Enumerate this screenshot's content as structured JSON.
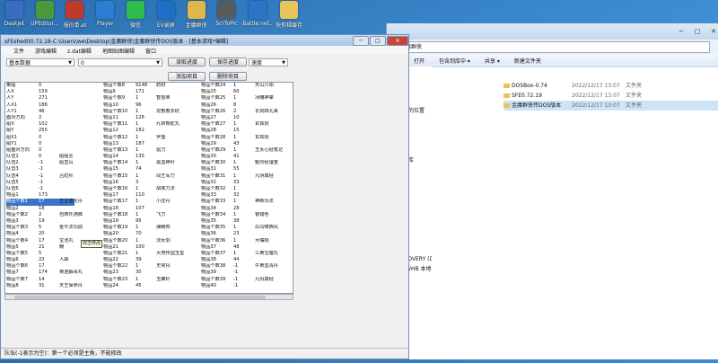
{
  "desktop": {
    "icons": [
      {
        "label": "Deskjet",
        "color": "#3b6cc4"
      },
      {
        "label": "UPEditor...",
        "color": "#4a9a3c"
      },
      {
        "label": "报价单.et",
        "color": "#c0392b"
      },
      {
        "label": "Player",
        "color": "#2a7fd4"
      },
      {
        "label": "微信",
        "color": "#2dbd4a"
      },
      {
        "label": "EV录屏",
        "color": "#1e6fc8"
      },
      {
        "label": "金庸群侠",
        "color": "#e0b84a"
      },
      {
        "label": "ScrToPic",
        "color": "#5a5a5a"
      },
      {
        "label": "Battle.net...",
        "color": "#2c74c9"
      },
      {
        "label": "快剪辑缓存",
        "color": "#e8c45a"
      }
    ]
  },
  "explorer": {
    "path": "金庸群侠",
    "toolbar": [
      "打开",
      "包含到库中 ▾",
      "共享 ▾",
      "新建文件夹"
    ],
    "sidebar": [
      "",
      "",
      "下载",
      "桌面",
      "最近访问的位置",
      "",
      "",
      "",
      "",
      "暴风影视库",
      "视频",
      "图片",
      "文档",
      "迅雷下载",
      "音乐",
      "",
      "",
      "计算机",
      "OS (C:)",
      "HP_RECOVERY (D:)",
      "Users (WHB 本地)",
      "",
      "",
      "网络",
      "",
      "",
      "",
      "",
      "",
      ""
    ],
    "files": [
      {
        "name": "DOSBox-0.74",
        "date": "2022/12/17 13:07",
        "type": "文件夹"
      },
      {
        "name": "SFE0.72.19",
        "date": "2022/12/17 13:07",
        "type": "文件夹"
      },
      {
        "name": "金庸群侠传DOS版本",
        "date": "2022/12/17 13:07",
        "type": "文件夹"
      }
    ]
  },
  "editor": {
    "title": "sFEshedit0.72.18-C:\\Users\\we\\Desktop\\金庸群侠\\金庸群侠传DOS版本 - [基本游戏*编辑]",
    "menu": [
      "文件",
      "游戏编辑",
      "z.dat编辑",
      "地图贴图编辑",
      "窗口"
    ],
    "select_category": "基本数据",
    "select_value": "0",
    "select_right": "速度",
    "buttons": {
      "read": "读取进度",
      "save": "保存进度",
      "add": "添加项目",
      "delete": "删除项目"
    },
    "tooltip": "双击修改",
    "status": "队伍(-1表示为空)：第一个必须是主角，不能修改",
    "grid": {
      "col1": [
        [
          "乘船",
          "0"
        ],
        [
          "人X",
          "159"
        ],
        [
          "人Y",
          "271"
        ],
        [
          "人X1",
          "186"
        ],
        [
          "人Y1",
          "46"
        ],
        [
          "面对方向",
          "2"
        ],
        [
          "船X",
          "102"
        ],
        [
          "船Y",
          "255"
        ],
        [
          "船X1",
          "0"
        ],
        [
          "船Y1",
          "0"
        ],
        [
          "船面对方向",
          "0"
        ],
        [
          "队伍1",
          "0"
        ],
        [
          "队伍2",
          "-1"
        ],
        [
          "队伍3",
          "-1"
        ],
        [
          "队伍4",
          "-1"
        ],
        [
          "队伍5",
          "-1"
        ],
        [
          "队伍6",
          "-1"
        ],
        [
          "物品1",
          "173"
        ],
        [
          "物品个数1",
          "17"
        ],
        [
          "物品2",
          "18"
        ],
        [
          "物品个数2",
          "2"
        ],
        [
          "物品3",
          "19"
        ],
        [
          "物品个数3",
          "5"
        ],
        [
          "物品4",
          "20"
        ],
        [
          "物品个数4",
          "17"
        ],
        [
          "物品5",
          "21"
        ],
        [
          "物品个数5",
          "5"
        ],
        [
          "物品6",
          "22"
        ],
        [
          "物品个数6",
          "17"
        ],
        [
          "物品7",
          "174"
        ],
        [
          "物品个数7",
          "14"
        ],
        [
          "物品8",
          "31"
        ]
      ],
      "col2": [
        [
          "",
          ""
        ],
        [
          "",
          ""
        ],
        [
          "",
          ""
        ],
        [
          "",
          ""
        ],
        [
          "",
          ""
        ],
        [
          "",
          ""
        ],
        [
          "",
          ""
        ],
        [
          "",
          ""
        ],
        [
          "",
          ""
        ],
        [
          "",
          ""
        ],
        [
          "",
          ""
        ],
        [
          "船船至",
          ""
        ],
        [
          "船里山",
          ""
        ],
        [
          "",
          ""
        ],
        [
          "吕虹纱",
          ""
        ],
        [
          "",
          ""
        ],
        [
          "",
          ""
        ],
        [
          "",
          ""
        ],
        [
          "王主蓝化丹",
          ""
        ],
        [
          "",
          ""
        ],
        [
          "自西氏骑裤",
          ""
        ],
        [
          "",
          ""
        ],
        [
          "金牛法功勋",
          ""
        ],
        [
          "",
          ""
        ],
        [
          "宝池丸",
          ""
        ],
        [
          "精",
          ""
        ],
        [
          "",
          ""
        ],
        [
          "人蒜",
          ""
        ],
        [
          "",
          ""
        ],
        [
          "黄连解毒丸",
          ""
        ],
        [
          "",
          ""
        ],
        [
          "天王保命丹",
          ""
        ]
      ],
      "col3": [
        [
          "物品个数8",
          "9148"
        ],
        [
          "物品9",
          "171"
        ],
        [
          "物品个数9",
          "1"
        ],
        [
          "物品10",
          "96"
        ],
        [
          "物品个数10",
          "1"
        ],
        [
          "物品11",
          "126"
        ],
        [
          "物品个数11",
          "1"
        ],
        [
          "物品12",
          "182"
        ],
        [
          "物品个数12",
          "1"
        ],
        [
          "物品13",
          "187"
        ],
        [
          "物品个数13",
          "1"
        ],
        [
          "物品14",
          "135"
        ],
        [
          "物品个数14",
          "1"
        ],
        [
          "物品15",
          "74"
        ],
        [
          "物品个数15",
          "1"
        ],
        [
          "物品16",
          "3"
        ],
        [
          "物品个数16",
          "1"
        ],
        [
          "物品17",
          "110"
        ],
        [
          "物品个数17",
          "1"
        ],
        [
          "物品18",
          "107"
        ],
        [
          "物品个数18",
          "1"
        ],
        [
          "物品19",
          "95"
        ],
        [
          "物品个数19",
          "1"
        ],
        [
          "物品20",
          "70"
        ],
        [
          "物品个数20",
          "1"
        ],
        [
          "物品21",
          "100"
        ],
        [
          "物品个数21",
          "1"
        ],
        [
          "物品22",
          "39"
        ],
        [
          "物品个数22",
          "1"
        ],
        [
          "物品23",
          "30"
        ],
        [
          "物品个数23",
          "1"
        ],
        [
          "物品24",
          "45"
        ]
      ],
      "col4": [
        [
          "药材",
          ""
        ],
        [
          "",
          ""
        ],
        [
          "智慧果",
          ""
        ],
        [
          "",
          ""
        ],
        [
          "龙敷着衣纺",
          ""
        ],
        [
          "",
          ""
        ],
        [
          "九转熊蛇丸",
          ""
        ],
        [
          "",
          ""
        ],
        [
          "罗盘",
          ""
        ],
        [
          "",
          ""
        ],
        [
          "鼠刀",
          ""
        ],
        [
          "",
          ""
        ],
        [
          "黑血神针",
          ""
        ],
        [
          "",
          ""
        ],
        [
          "闯王军刀",
          ""
        ],
        [
          "",
          ""
        ],
        [
          "胡家刀法",
          ""
        ],
        [
          "",
          ""
        ],
        [
          "小还丹",
          ""
        ],
        [
          "",
          ""
        ],
        [
          "飞刀",
          ""
        ],
        [
          "",
          ""
        ],
        [
          "弹腾肉",
          ""
        ],
        [
          "",
          ""
        ],
        [
          "淡女剑",
          ""
        ],
        [
          "",
          ""
        ],
        [
          "大燕传国玉玺",
          ""
        ],
        [
          "",
          ""
        ],
        [
          "无常丹",
          ""
        ],
        [
          "",
          ""
        ],
        [
          "玉蜂针",
          ""
        ],
        [
          "",
          ""
        ]
      ],
      "col5": [
        [
          "物品个数24",
          "1"
        ],
        [
          "物品25",
          "60"
        ],
        [
          "物品个数25",
          "1"
        ],
        [
          "物品26",
          "8"
        ],
        [
          "物品个数26",
          "2"
        ],
        [
          "物品27",
          "10"
        ],
        [
          "物品个数27",
          "1"
        ],
        [
          "物品28",
          "15"
        ],
        [
          "物品个数28",
          "1"
        ],
        [
          "物品29",
          "43"
        ],
        [
          "物品个数29",
          "1"
        ],
        [
          "物品30",
          "41"
        ],
        [
          "物品个数30",
          "1"
        ],
        [
          "物品31",
          "55"
        ],
        [
          "物品个数31",
          "1"
        ],
        [
          "物品32",
          "33"
        ],
        [
          "物品个数32",
          "1"
        ],
        [
          "物品33",
          "32"
        ],
        [
          "物品个数33",
          "1"
        ],
        [
          "物品34",
          "28"
        ],
        [
          "物品个数34",
          "1"
        ],
        [
          "物品35",
          "38"
        ],
        [
          "物品个数35",
          "1"
        ],
        [
          "物品36",
          "23"
        ],
        [
          "物品个数36",
          "1"
        ],
        [
          "物品37",
          "48"
        ],
        [
          "物品个数37",
          "1"
        ],
        [
          "物品38",
          "44"
        ],
        [
          "物品个数38",
          "-1"
        ],
        [
          "物品39",
          "-1"
        ],
        [
          "物品个数39",
          "-1"
        ],
        [
          "物品40",
          "-1"
        ]
      ],
      "col6": [
        [
          "天山六阳",
          ""
        ],
        [
          "",
          ""
        ],
        [
          "冰魄神掌",
          ""
        ],
        [
          "",
          ""
        ],
        [
          "长剑四孔来",
          ""
        ],
        [
          "",
          ""
        ],
        [
          "玄铁剑",
          ""
        ],
        [
          "",
          ""
        ],
        [
          "玄铁剑",
          ""
        ],
        [
          "",
          ""
        ],
        [
          "玉女心经笔记",
          ""
        ],
        [
          "",
          ""
        ],
        [
          "魁烈经谊重",
          ""
        ],
        [
          "",
          ""
        ],
        [
          "九阴真经",
          ""
        ],
        [
          "",
          ""
        ],
        [
          "",
          ""
        ],
        [
          "",
          ""
        ],
        [
          "神断功法",
          ""
        ],
        [
          "",
          ""
        ],
        [
          "银错色",
          ""
        ],
        [
          "",
          ""
        ],
        [
          "白马啸西风",
          ""
        ],
        [
          "",
          ""
        ],
        [
          "大嘴桃",
          ""
        ],
        [
          "",
          ""
        ],
        [
          "三黄宝腊丸",
          ""
        ],
        [
          "",
          ""
        ],
        [
          "牛黄血清丹",
          ""
        ],
        [
          "",
          ""
        ],
        [
          "九阳真经",
          ""
        ],
        [
          "",
          ""
        ]
      ]
    }
  }
}
